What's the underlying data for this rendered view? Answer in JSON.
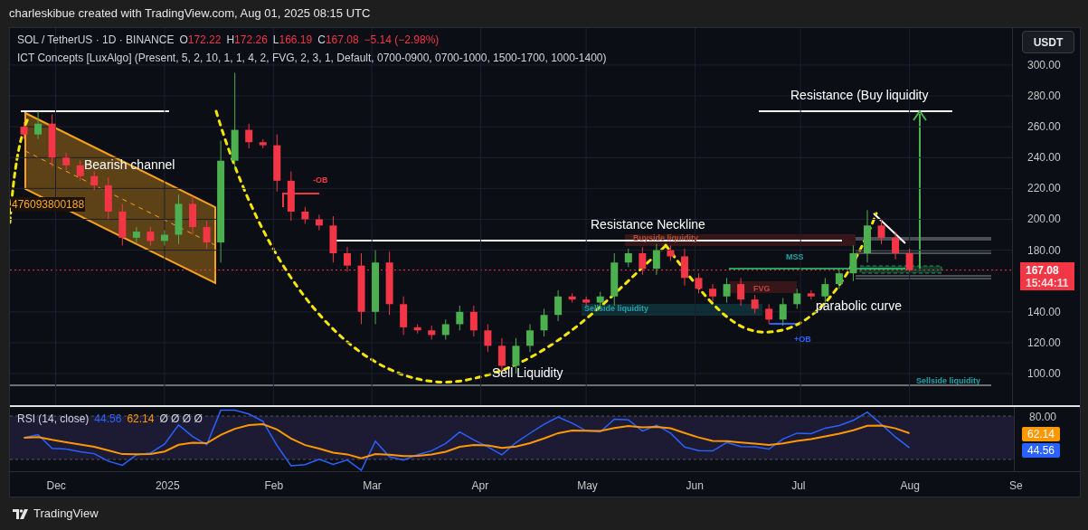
{
  "header": {
    "caption": "charleskibue created with TradingView.com, Aug 01, 2025 08:15 UTC"
  },
  "legend": {
    "symbol": "SOL / TetherUS · 1D · BINANCE",
    "ohlc": [
      {
        "label": "O",
        "value": "172.22"
      },
      {
        "label": "H",
        "value": "172.26"
      },
      {
        "label": "L",
        "value": "166.19"
      },
      {
        "label": "C",
        "value": "167.08"
      }
    ],
    "change": "−5.14 (−2.98%)"
  },
  "indicator": {
    "text": "ICT Concepts [LuxAlgo] (Present, 5, 2, 10, 1, 1, 4, 2, FVG, 2, 3, 1, Default, 0700-0900, 0700-1000, 1500-1700, 1000-1400)"
  },
  "currency_button": "USDT",
  "price_tag": {
    "price": "167.08",
    "countdown": "15:44:11"
  },
  "main_chart": {
    "chart_data": {
      "type": "candlestick",
      "grid": true,
      "ylim": [
        79.5,
        324
      ],
      "xlim": [
        "2024-11-18",
        "2025-09-19"
      ],
      "x": [
        "2024-11-22",
        "2024-11-26",
        "2024-11-30",
        "2024-12-04",
        "2024-12-08",
        "2024-12-12",
        "2024-12-16",
        "2024-12-20",
        "2024-12-24",
        "2024-12-28",
        "2025-01-01",
        "2025-01-05",
        "2025-01-09",
        "2025-01-13",
        "2025-01-17",
        "2025-01-21",
        "2025-01-25",
        "2025-01-29",
        "2025-02-02",
        "2025-02-06",
        "2025-02-10",
        "2025-02-14",
        "2025-02-18",
        "2025-02-22",
        "2025-02-26",
        "2025-03-02",
        "2025-03-06",
        "2025-03-10",
        "2025-03-14",
        "2025-03-18",
        "2025-03-22",
        "2025-03-26",
        "2025-03-30",
        "2025-04-03",
        "2025-04-07",
        "2025-04-11",
        "2025-04-15",
        "2025-04-19",
        "2025-04-23",
        "2025-04-27",
        "2025-05-01",
        "2025-05-05",
        "2025-05-09",
        "2025-05-13",
        "2025-05-17",
        "2025-05-21",
        "2025-05-25",
        "2025-05-29",
        "2025-06-02",
        "2025-06-06",
        "2025-06-10",
        "2025-06-14",
        "2025-06-18",
        "2025-06-22",
        "2025-06-26",
        "2025-06-30",
        "2025-07-04",
        "2025-07-08",
        "2025-07-12",
        "2025-07-16",
        "2025-07-20",
        "2025-07-24",
        "2025-07-28",
        "2025-08-01"
      ],
      "xticks": [
        {
          "value": "2024-12-01",
          "label": "Dec"
        },
        {
          "value": "2025-01-01",
          "label": "2025"
        },
        {
          "value": "2025-02-01",
          "label": "Feb"
        },
        {
          "value": "2025-03-01",
          "label": "Mar"
        },
        {
          "value": "2025-04-01",
          "label": "Apr"
        },
        {
          "value": "2025-05-01",
          "label": "May"
        },
        {
          "value": "2025-06-01",
          "label": "Jun"
        },
        {
          "value": "2025-07-01",
          "label": "Jul"
        },
        {
          "value": "2025-08-01",
          "label": "Aug"
        },
        {
          "value": "2025-09-01",
          "label": "Se"
        }
      ],
      "ohlc": [
        [
          260,
          263,
          252,
          255
        ],
        [
          255,
          270,
          252,
          262
        ],
        [
          262,
          268,
          234,
          240
        ],
        [
          240,
          243,
          232,
          235
        ],
        [
          235,
          238,
          225,
          228
        ],
        [
          228,
          231,
          219,
          222
        ],
        [
          222,
          227,
          200,
          205
        ],
        [
          205,
          210,
          183,
          188
        ],
        [
          188,
          195,
          185,
          192
        ],
        [
          192,
          195,
          183,
          186
        ],
        [
          186,
          193,
          183,
          190
        ],
        [
          190,
          216,
          184,
          210
        ],
        [
          210,
          215,
          190,
          195
        ],
        [
          195,
          199,
          181,
          185
        ],
        [
          185,
          251,
          172,
          238
        ],
        [
          238,
          295,
          232,
          258
        ],
        [
          258,
          262,
          246,
          250
        ],
        [
          250,
          252,
          246,
          248
        ],
        [
          248,
          255,
          218,
          225
        ],
        [
          225,
          231,
          199,
          205
        ],
        [
          205,
          208,
          197,
          200
        ],
        [
          200,
          203,
          193,
          196
        ],
        [
          196,
          202,
          172,
          178
        ],
        [
          178,
          182,
          166,
          170
        ],
        [
          170,
          178,
          132,
          140
        ],
        [
          140,
          180,
          132,
          172
        ],
        [
          172,
          179,
          138,
          145
        ],
        [
          145,
          150,
          125,
          130
        ],
        [
          130,
          132,
          126,
          128
        ],
        [
          128,
          131,
          122,
          125
        ],
        [
          125,
          135,
          122,
          132
        ],
        [
          132,
          144,
          128,
          140
        ],
        [
          140,
          144,
          124,
          128
        ],
        [
          128,
          132,
          114,
          118
        ],
        [
          118,
          123,
          100,
          105
        ],
        [
          105,
          123,
          100,
          118
        ],
        [
          118,
          132,
          114,
          128
        ],
        [
          128,
          142,
          124,
          138
        ],
        [
          138,
          154,
          134,
          150
        ],
        [
          150,
          152,
          146,
          148
        ],
        [
          148,
          150,
          144,
          146
        ],
        [
          146,
          153,
          143,
          150
        ],
        [
          150,
          178,
          144,
          172
        ],
        [
          172,
          181,
          169,
          178
        ],
        [
          178,
          182,
          164,
          168
        ],
        [
          168,
          184,
          164,
          180
        ],
        [
          180,
          183,
          173,
          176
        ],
        [
          176,
          181,
          157,
          162
        ],
        [
          162,
          165,
          152,
          155
        ],
        [
          155,
          158,
          147,
          150
        ],
        [
          150,
          162,
          146,
          158
        ],
        [
          158,
          162,
          144,
          148
        ],
        [
          148,
          151,
          139,
          142
        ],
        [
          142,
          145,
          132,
          135
        ],
        [
          135,
          149,
          131,
          145
        ],
        [
          145,
          155,
          142,
          152
        ],
        [
          152,
          154,
          148,
          150
        ],
        [
          150,
          162,
          146,
          158
        ],
        [
          158,
          168,
          155,
          165
        ],
        [
          165,
          183,
          160,
          178
        ],
        [
          178,
          206,
          172,
          196
        ],
        [
          196,
          200,
          184,
          188
        ],
        [
          188,
          192,
          174,
          178
        ],
        [
          178,
          181,
          166,
          167.08
        ]
      ],
      "yticks": [
        {
          "value": 100,
          "label": "100.00"
        },
        {
          "value": 120,
          "label": "120.00"
        },
        {
          "value": 140,
          "label": "140.00"
        },
        {
          "value": 180,
          "label": "180.00"
        },
        {
          "value": 200,
          "label": "200.00"
        },
        {
          "value": 220,
          "label": "220.00"
        },
        {
          "value": 240,
          "label": "240.00"
        },
        {
          "value": 260,
          "label": "260.00"
        },
        {
          "value": 280,
          "label": "280.00"
        },
        {
          "value": 300,
          "label": "300.00"
        }
      ]
    }
  },
  "annotations": [
    {
      "kind": "callout",
      "text": "Bearish channel",
      "color": "#ffffff"
    },
    {
      "kind": "number",
      "text": "476093800188",
      "color": "#ffa726"
    },
    {
      "kind": "tag",
      "text": "-OB",
      "color": "#f23645"
    },
    {
      "kind": "callout",
      "text": "Resistance Neckline",
      "color": "#ffffff"
    },
    {
      "kind": "tag",
      "text": "Buyside liquidity",
      "color": "#b0503c"
    },
    {
      "kind": "tag",
      "text": "Sellside liquidity",
      "color": "#1fa3a8"
    },
    {
      "kind": "tag",
      "text": "MSS",
      "color": "#1fa3a8"
    },
    {
      "kind": "tag",
      "text": "FVG",
      "color": "#c0453c"
    },
    {
      "kind": "callout",
      "text": "parabolic curve",
      "color": "#ffffff"
    },
    {
      "kind": "tag",
      "text": "+OB",
      "color": "#2962ff"
    },
    {
      "kind": "callout",
      "text": "Sell Liquidity",
      "color": "#ffffff"
    },
    {
      "kind": "callout",
      "text": "Resistance (Buy liquidity",
      "color": "#ffffff"
    },
    {
      "kind": "tag",
      "text": "Sellside liquidity",
      "color": "#1fa3a8"
    }
  ],
  "rsi": {
    "title": "RSI (14, close)",
    "values": [
      {
        "text": "44.56",
        "color": "#2962ff"
      },
      {
        "text": "62.14",
        "color": "#ff9800"
      }
    ],
    "flags": "Ø Ø Ø Ø",
    "axis_label": "80.00",
    "tags": [
      {
        "text": "62.14",
        "color": "#ff9800"
      },
      {
        "text": "44.56",
        "color": "#2962ff"
      }
    ]
  },
  "footer": {
    "brand": "TradingView"
  }
}
